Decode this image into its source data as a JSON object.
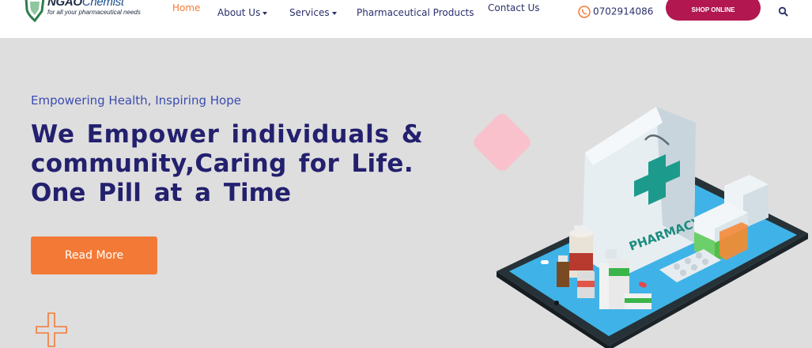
{
  "logo": {
    "name_main": "NGAO",
    "name_sub": "Chemist",
    "tagline": "for all your pharmaceutical needs"
  },
  "nav": {
    "items": [
      {
        "label": "Home",
        "active": true,
        "dropdown": false
      },
      {
        "label": "About Us",
        "active": false,
        "dropdown": true
      },
      {
        "label": "Services",
        "active": false,
        "dropdown": true
      },
      {
        "label": "Pharmaceutical Products",
        "active": false,
        "dropdown": false
      },
      {
        "label": "Contact Us",
        "active": false,
        "dropdown": false
      }
    ],
    "phone": "0702914086",
    "shop_label": "SHOP ONLINE"
  },
  "hero": {
    "tagline": "Empowering Health, Inspiring Hope",
    "headline": [
      "We Empower individuals &",
      "community,Caring for Life.",
      "One Pill at a Time"
    ],
    "button_label": "Read More",
    "illustration_text": "PHARMACY"
  },
  "colors": {
    "accent": "#f37a36",
    "brand": "#b3174f",
    "heading": "#23206e",
    "nav_text": "#2a2f6b",
    "tagline": "#3b4cb0",
    "background": "#dedede"
  },
  "icons": [
    "shield-logo-icon",
    "phone-icon",
    "search-icon",
    "chevron-down-icon",
    "plus-decoration-icon",
    "pharmacy-illustration"
  ]
}
